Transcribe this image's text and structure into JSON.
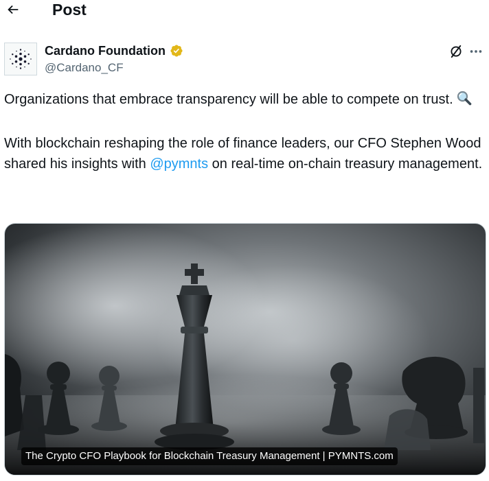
{
  "header": {
    "title": "Post"
  },
  "author": {
    "name": "Cardano Foundation",
    "handle": "@Cardano_CF",
    "verified_color": "#e2b719"
  },
  "post": {
    "paragraph1": "Organizations that embrace transparency will be able to compete on trust.",
    "paragraph2_before": "With blockchain reshaping the role of finance leaders, our CFO Stephen Wood shared his insights with ",
    "mention": "@pymnts",
    "paragraph2_after": " on real-time on-chain treasury management."
  },
  "card": {
    "caption": "The Crypto CFO Playbook for Blockchain Treasury Management | PYMNTS.com"
  },
  "icons": {
    "back": "arrow-left-icon",
    "avatar": "cardano-logo-icon",
    "verified": "verified-badge-icon",
    "grok": "grok-icon",
    "more": "more-horizontal-icon",
    "emoji": "magnifying-glass-icon"
  },
  "colors": {
    "text": "#0f1419",
    "secondary": "#536471",
    "link": "#1d9bf0",
    "border": "#cfd9de"
  }
}
